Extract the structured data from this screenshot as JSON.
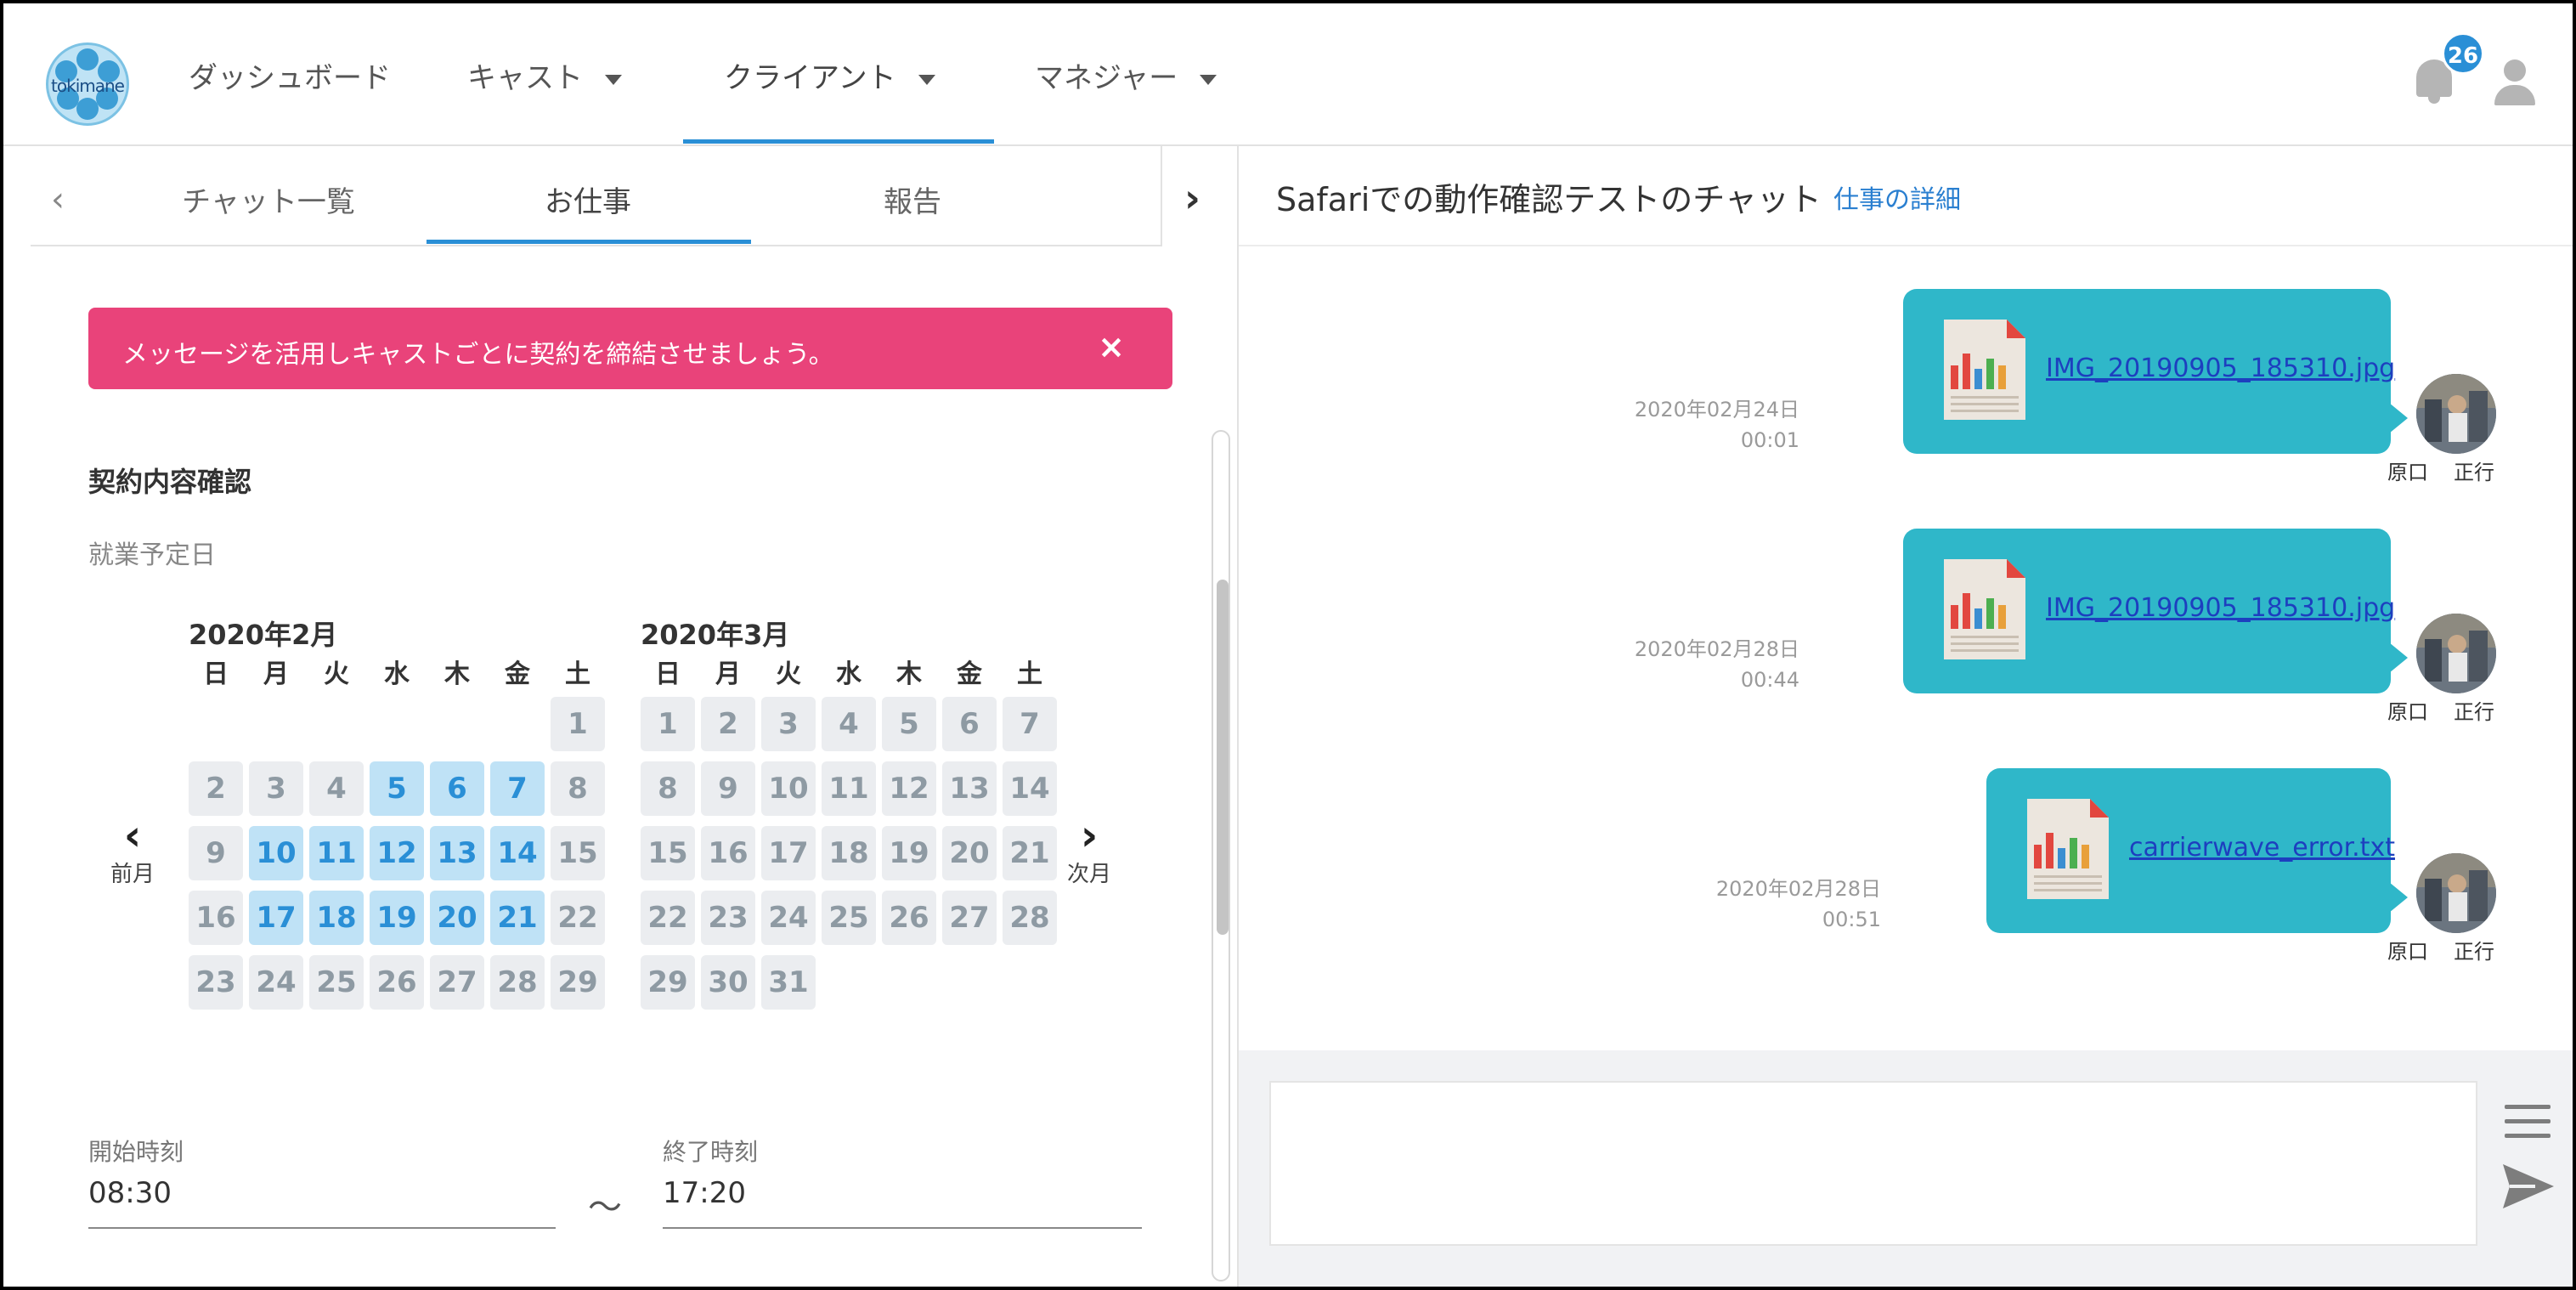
{
  "header": {
    "logo_text": "tokimane",
    "nav": [
      {
        "label": "ダッシュボード"
      },
      {
        "label": "キャスト"
      },
      {
        "label": "クライアント"
      },
      {
        "label": "マネジャー"
      }
    ],
    "notification_count": "26",
    "accent": "#2a8fd6"
  },
  "left": {
    "tabs": [
      "チャット一覧",
      "お仕事",
      "報告"
    ],
    "active_tab": "お仕事",
    "alert": "メッセージを活用しキャストごとに契約を締結させましょう。",
    "alert_close": "×",
    "section_title": "契約内容確認",
    "section_sub": "就業予定日",
    "prev_label": "前月",
    "next_label": "次月",
    "weekdays": [
      "日",
      "月",
      "火",
      "水",
      "木",
      "金",
      "土"
    ],
    "months": [
      {
        "title": "2020年2月",
        "first_weekday": 6,
        "days": 29,
        "selected": [
          5,
          6,
          7,
          10,
          11,
          12,
          13,
          14,
          17,
          18,
          19,
          20,
          21
        ]
      },
      {
        "title": "2020年3月",
        "first_weekday": 0,
        "days": 31,
        "selected": []
      }
    ],
    "start_label": "開始時刻",
    "start_value": "08:30",
    "end_label": "終了時刻",
    "end_value": "17:20",
    "tilde": "〜"
  },
  "right": {
    "chat_title": "Safariでの動作確認テストのチャット",
    "chat_link": "仕事の詳細",
    "messages": [
      {
        "file": "IMG_20190905_185310.jpg",
        "date": "2020年02月24日",
        "time": "00:01",
        "sender_last": "原口",
        "sender_first": "正行"
      },
      {
        "file": "IMG_20190905_185310.jpg",
        "date": "2020年02月28日",
        "time": "00:44",
        "sender_last": "原口",
        "sender_first": "正行"
      },
      {
        "file": "carrierwave_error.txt",
        "date": "2020年02月28日",
        "time": "00:51",
        "sender_last": "原口",
        "sender_first": "正行"
      }
    ],
    "bubble_color": "#2fb7c9",
    "alert_color": "#e9437a"
  }
}
